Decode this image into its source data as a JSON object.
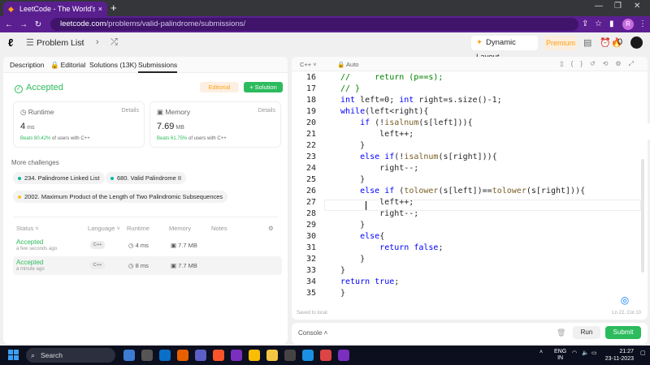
{
  "browser": {
    "tab_title": "LeetCode - The World's Leading",
    "tab_close": "×",
    "new_tab": "+",
    "url_host": "leetcode.com",
    "url_path": "/problems/valid-palindrome/submissions/",
    "profile_initial": "R"
  },
  "header": {
    "problem_list": "Problem List",
    "dynamic_layout": "Dynamic Layout",
    "premium": "Premium",
    "streak_count": "0"
  },
  "left": {
    "tabs": [
      "Description",
      "Editorial",
      "Solutions (13K)",
      "Submissions"
    ],
    "result": "Accepted",
    "editorial_btn": "Editorial",
    "solution_btn": "+ Solution",
    "runtime": {
      "label": "Runtime",
      "details": "Details",
      "value": "4",
      "unit": "ms",
      "beats_pct": "Beats 80.42%",
      "beats_rest": "of users with C++"
    },
    "memory": {
      "label": "Memory",
      "details": "Details",
      "value": "7.69",
      "unit": "MB",
      "beats_pct": "Beats 61.75%",
      "beats_rest": "of users with C++"
    },
    "more_challenges": "More challenges",
    "challenges": [
      {
        "label": "234. Palindrome Linked List",
        "color": "#00b8a3"
      },
      {
        "label": "680. Valid Palindrome II",
        "color": "#00b8a3"
      },
      {
        "label": "2002. Maximum Product of the Length of Two Palindromic Subsequences",
        "color": "#ffc01e"
      }
    ],
    "table_headers": [
      "Status",
      "Language",
      "Runtime",
      "Memory",
      "Notes"
    ],
    "rows": [
      {
        "status": "Accepted",
        "time": "a few seconds ago",
        "language": "C++",
        "runtime": "4 ms",
        "memory": "7.7 MB"
      },
      {
        "status": "Accepted",
        "time": "a minute ago",
        "language": "C++",
        "runtime": "8 ms",
        "memory": "7.7 MB"
      }
    ]
  },
  "editor": {
    "language": "C++",
    "mode": "Auto",
    "line_numbers": [
      "16",
      "17",
      "18",
      "19",
      "20",
      "21",
      "22",
      "23",
      "24",
      "25",
      "26",
      "27",
      "28",
      "29",
      "30",
      "31",
      "32",
      "33",
      "34",
      "35"
    ],
    "lines": [
      "//     return (p==s);",
      "// }",
      "int left=0; int right=s.size()-1;",
      "while(left<right){",
      "    if (!isalnum(s[left])){",
      "        left++;",
      "    }",
      "    else if(!isalnum(s[right])){",
      "        right--;",
      "    }",
      "    else if (tolower(s[left])==tolower(s[right])){",
      "        left++;",
      "        right--;",
      "    }",
      "    else{",
      "        return false;",
      "    }",
      "}",
      "return true;",
      "}"
    ],
    "saved": "Saved to local",
    "cursor_pos": "Ln 22, Col 10"
  },
  "console": {
    "label": "Console",
    "run": "Run",
    "submit": "Submit"
  },
  "taskbar": {
    "search": "Search",
    "lang_line1": "ENG",
    "lang_line2": "IN",
    "time": "21:27",
    "date": "23-11-2023"
  }
}
